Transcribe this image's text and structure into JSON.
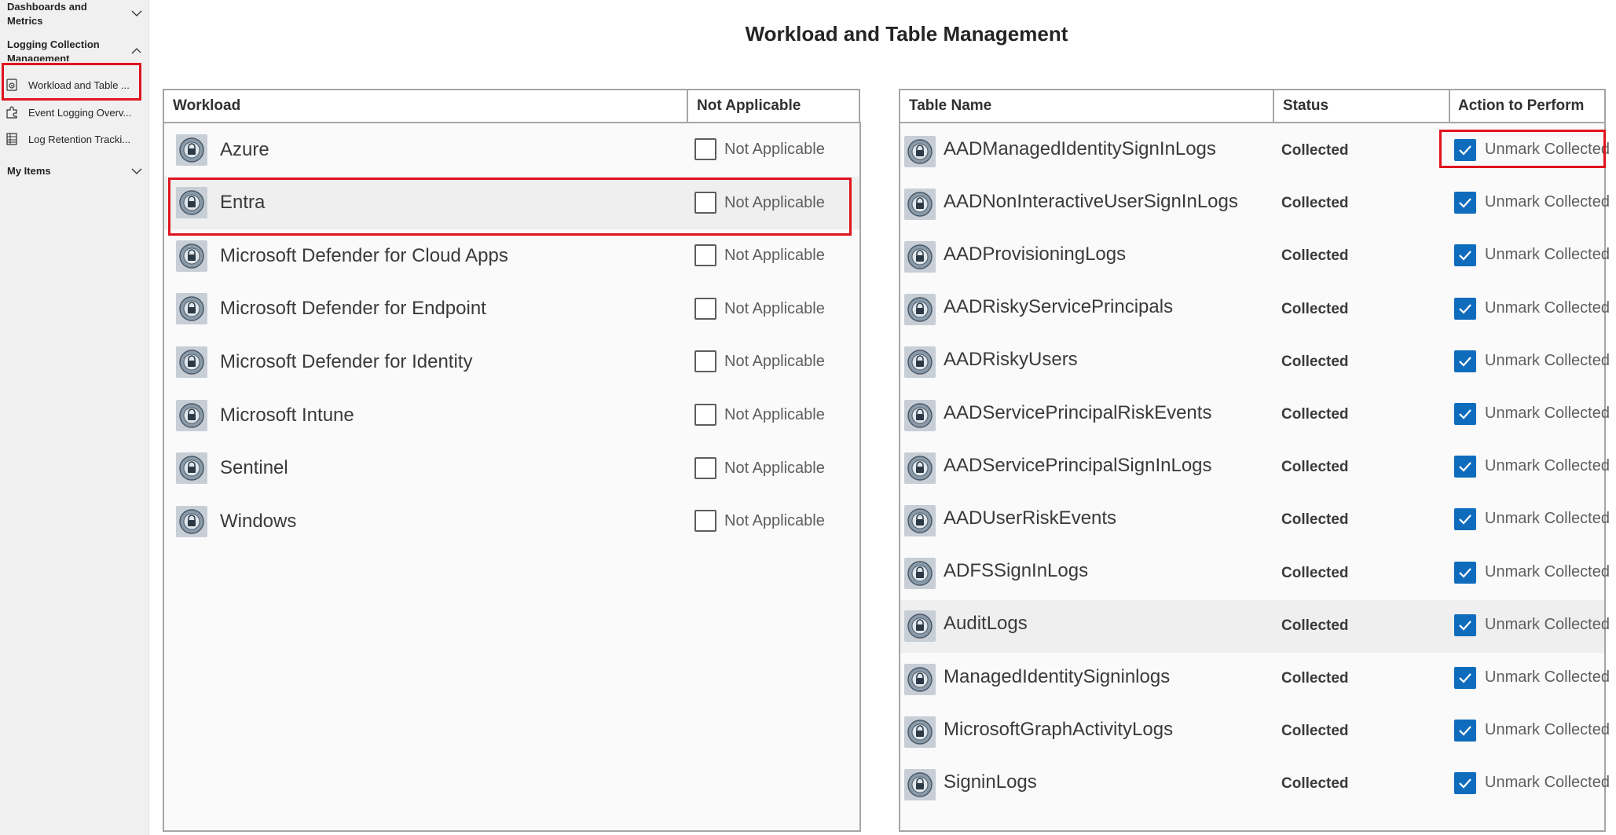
{
  "sidebar": {
    "groups": [
      {
        "label": "Dashboards and Metrics",
        "expanded": false
      },
      {
        "label": "Logging Collection Management",
        "expanded": true
      },
      {
        "label": "My Items",
        "expanded": false
      }
    ],
    "items": [
      {
        "label": "Workload and Table ...",
        "icon": "settings-doc-icon",
        "selected": true
      },
      {
        "label": "Event Logging Overv...",
        "icon": "puzzle-icon",
        "selected": false
      },
      {
        "label": "Log Retention Tracki...",
        "icon": "table-icon",
        "selected": false
      }
    ]
  },
  "page": {
    "title": "Workload and Table Management"
  },
  "workloads": {
    "columns": [
      "Workload",
      "Not Applicable"
    ],
    "checkbox_label": "Not Applicable",
    "rows": [
      {
        "name": "Azure",
        "not_applicable": false,
        "selected": false
      },
      {
        "name": "Entra",
        "not_applicable": false,
        "selected": true
      },
      {
        "name": "Microsoft Defender for Cloud Apps",
        "not_applicable": false,
        "selected": false
      },
      {
        "name": "Microsoft Defender for Endpoint",
        "not_applicable": false,
        "selected": false
      },
      {
        "name": "Microsoft Defender for Identity",
        "not_applicable": false,
        "selected": false
      },
      {
        "name": "Microsoft Intune",
        "not_applicable": false,
        "selected": false
      },
      {
        "name": "Sentinel",
        "not_applicable": false,
        "selected": false
      },
      {
        "name": "Windows",
        "not_applicable": false,
        "selected": false
      }
    ]
  },
  "tables": {
    "columns": [
      "Table Name",
      "Status",
      "Action to Perform"
    ],
    "action_label": "Unmark Collected",
    "rows": [
      {
        "name": "AADManagedIdentitySignInLogs",
        "status": "Collected",
        "checked": true,
        "hover": false
      },
      {
        "name": "AADNonInteractiveUserSignInLogs",
        "status": "Collected",
        "checked": true,
        "hover": false
      },
      {
        "name": "AADProvisioningLogs",
        "status": "Collected",
        "checked": true,
        "hover": false
      },
      {
        "name": "AADRiskyServicePrincipals",
        "status": "Collected",
        "checked": true,
        "hover": false
      },
      {
        "name": "AADRiskyUsers",
        "status": "Collected",
        "checked": true,
        "hover": false
      },
      {
        "name": "AADServicePrincipalRiskEvents",
        "status": "Collected",
        "checked": true,
        "hover": false
      },
      {
        "name": "AADServicePrincipalSignInLogs",
        "status": "Collected",
        "checked": true,
        "hover": false
      },
      {
        "name": "AADUserRiskEvents",
        "status": "Collected",
        "checked": true,
        "hover": false
      },
      {
        "name": "ADFSSignInLogs",
        "status": "Collected",
        "checked": true,
        "hover": false
      },
      {
        "name": "AuditLogs",
        "status": "Collected",
        "checked": true,
        "hover": true
      },
      {
        "name": "ManagedIdentitySigninlogs",
        "status": "Collected",
        "checked": true,
        "hover": false
      },
      {
        "name": "MicrosoftGraphActivityLogs",
        "status": "Collected",
        "checked": true,
        "hover": false
      },
      {
        "name": "SigninLogs",
        "status": "Collected",
        "checked": true,
        "hover": false
      }
    ]
  },
  "colors": {
    "checkbox_checked": "#0f6cbd",
    "highlight": "#e0141e",
    "row_selected": "#efefef"
  }
}
